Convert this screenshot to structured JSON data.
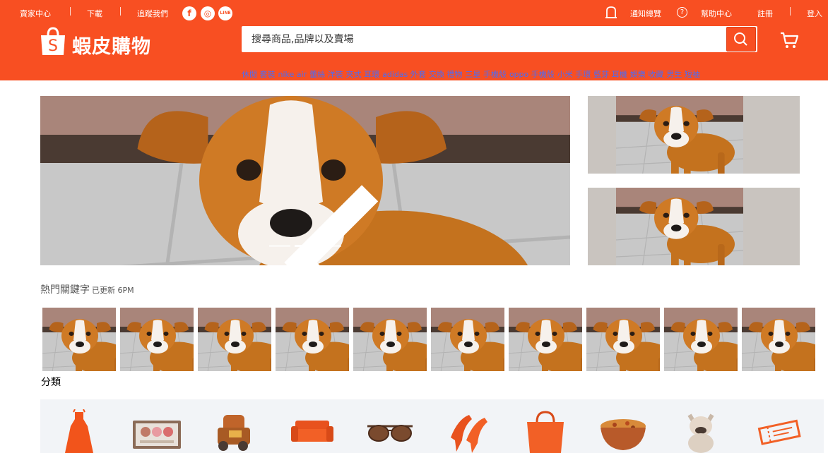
{
  "topbar": {
    "seller_center": "賣家中心",
    "download": "下載",
    "follow_us": "追蹤我們",
    "social_facebook": "f",
    "social_instagram": "◎",
    "social_line": "LINE",
    "notifications": "通知總覽",
    "help": "幫助中心",
    "register": "註冊",
    "login": "登入"
  },
  "brand": {
    "name": "蝦皮購物",
    "logo_letter": "S"
  },
  "search": {
    "placeholder": "搜尋商品,品牌以及賣場"
  },
  "hot_links": [
    "休閒 套裝",
    "nike air",
    "蕾絲 洋裝",
    "夾式 耳環",
    "adidas 外套",
    "交換 禮物",
    "三星 手機殼",
    "oppo 手機殼",
    "小米 手環",
    "藍芽 耳機",
    "娛樂 收藏",
    "男生 短袖"
  ],
  "banner": {
    "slide_count": 3,
    "active_slide": 2
  },
  "hot_keywords": {
    "title": "熱門關鍵字",
    "updated": "已更新 6PM",
    "thumbnail_count": 10
  },
  "categories": {
    "title": "分類",
    "icons": [
      "dress-icon",
      "eyeshadow-palette-icon",
      "toy-train-icon",
      "sofa-icon",
      "sunglasses-icon",
      "high-heels-icon",
      "handbag-icon",
      "food-bowl-icon",
      "bulldog-icon",
      "tickets-icon"
    ]
  },
  "colors": {
    "brand": "#f84f22",
    "link": "#4b6cf6",
    "category_bg": "#f2f4f7"
  }
}
